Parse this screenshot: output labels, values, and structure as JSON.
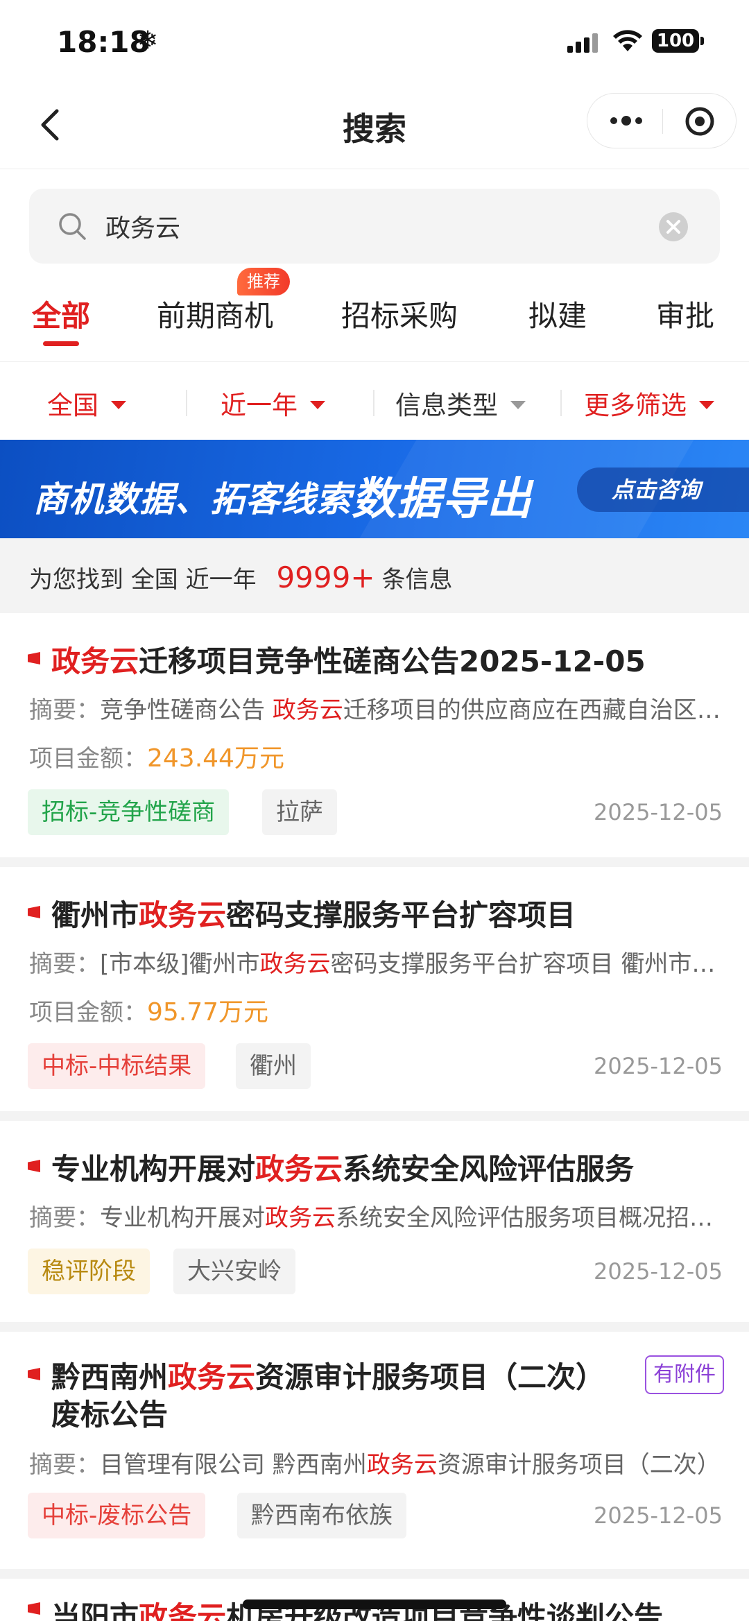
{
  "status_bar": {
    "time": "18:18",
    "battery": "100"
  },
  "nav": {
    "title": "搜索"
  },
  "search": {
    "value": "政务云"
  },
  "tabs": [
    {
      "label": "全部",
      "active": true
    },
    {
      "label": "前期商机",
      "badge": "推荐"
    },
    {
      "label": "招标采购"
    },
    {
      "label": "拟建"
    },
    {
      "label": "审批"
    }
  ],
  "filters": [
    {
      "label": "全国",
      "active": true
    },
    {
      "label": "近一年",
      "active": true
    },
    {
      "label": "信息类型",
      "active": false
    },
    {
      "label": "更多筛选",
      "active": true
    }
  ],
  "banner": {
    "text": "商机数据、拓客线索",
    "text_big": "数据导出",
    "cta": "点击咨询"
  },
  "summary": {
    "prefix": "为您找到",
    "region": "全国",
    "period": "近一年",
    "count": "9999+",
    "suffix": "条信息"
  },
  "results": [
    {
      "title_pre": "",
      "title_hl": "政务云",
      "title_post": "迁移项目竞争性磋商公告2025-12-05",
      "summary_label": "摘要：",
      "summary_pre": "竞争性磋商公告 ",
      "summary_hl": "政务云",
      "summary_post": "迁移项目的供应商应在西藏自治区政府采购网获取",
      "amount_label": "项目金额：",
      "amount": "243.44万元",
      "tags": [
        {
          "text": "招标-竞争性磋商",
          "style": "green"
        },
        {
          "text": "拉萨",
          "style": "gray"
        }
      ],
      "date": "2025-12-05"
    },
    {
      "title_pre": "衢州市",
      "title_hl": "政务云",
      "title_post": "密码支撑服务平台扩容项目",
      "summary_label": "摘要：",
      "summary_pre": "[市本级]衢州市",
      "summary_hl": "政务云",
      "summary_post": "密码支撑服务平台扩容项目 衢州市政务服务",
      "amount_label": "项目金额：",
      "amount": "95.77万元",
      "tags": [
        {
          "text": "中标-中标结果",
          "style": "red"
        },
        {
          "text": "衢州",
          "style": "gray"
        }
      ],
      "date": "2025-12-05"
    },
    {
      "title_pre": "专业机构开展对",
      "title_hl": "政务云",
      "title_post": "系统安全风险评估服务",
      "summary_label": "摘要：",
      "summary_pre": "专业机构开展对",
      "summary_hl": "政务云",
      "summary_post": "系统安全风险评估服务项目概况招标文件",
      "tags": [
        {
          "text": "稳评阶段",
          "style": "yellow"
        },
        {
          "text": "大兴安岭",
          "style": "gray"
        }
      ],
      "date": "2025-12-05"
    },
    {
      "title_pre": "黔西南州",
      "title_hl": "政务云",
      "title_post": "资源审计服务项目（二次）",
      "title_line2": "废标公告",
      "attach": "有附件",
      "summary_label": "摘要：",
      "summary_pre": "目管理有限公司 黔西南州",
      "summary_hl": "政务云",
      "summary_post": "资源审计服务项目（二次）",
      "tags": [
        {
          "text": "中标-废标公告",
          "style": "red"
        },
        {
          "text": "黔西南布依族",
          "style": "gray"
        }
      ],
      "date": "2025-12-05"
    },
    {
      "title_pre": "当阳市",
      "title_hl": "政务云",
      "title_post": "机房升级改造项目竞争性谈判公告"
    }
  ]
}
